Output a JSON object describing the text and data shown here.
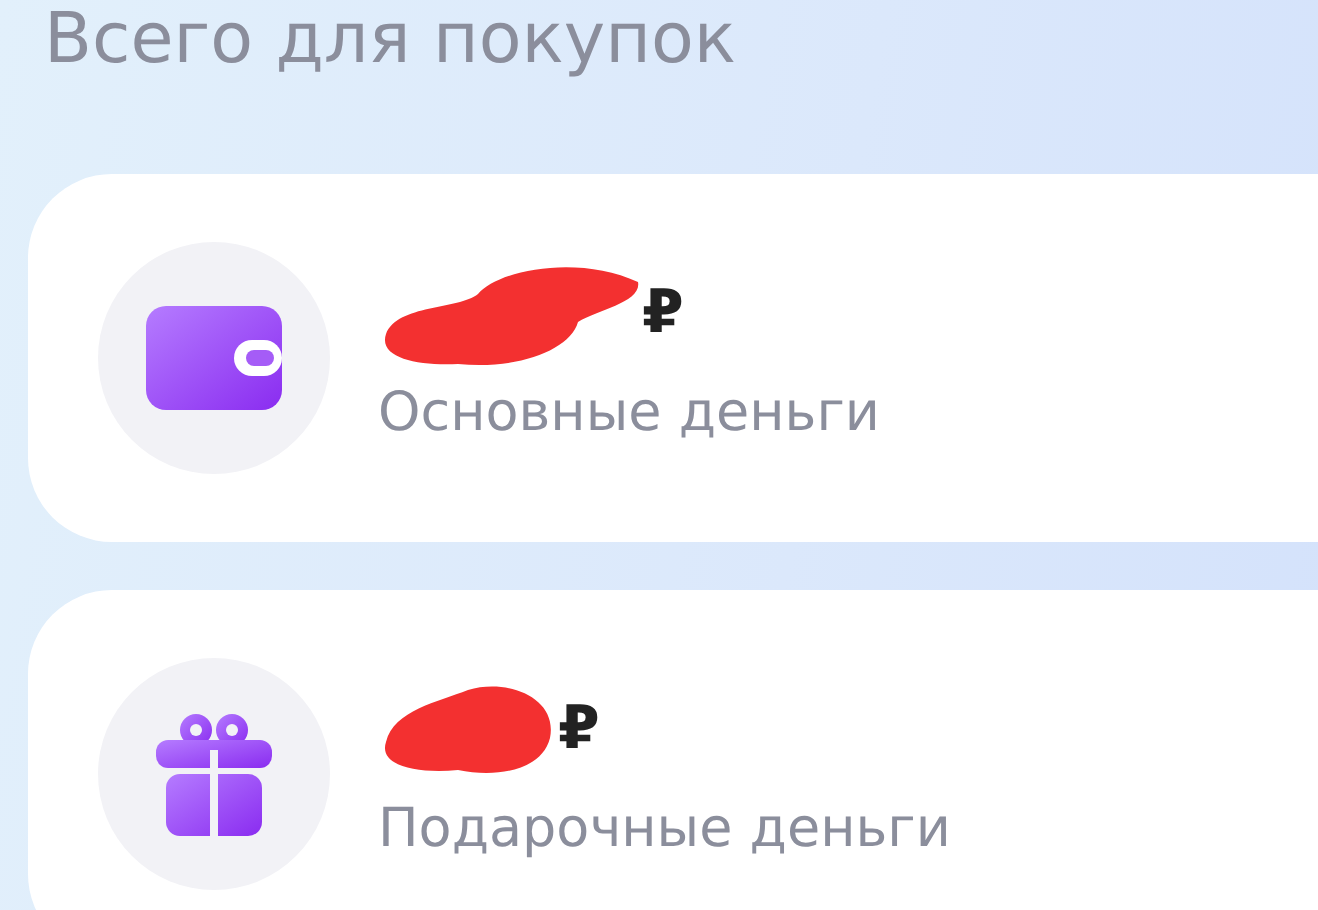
{
  "title": "Всего для покупок",
  "accounts": [
    {
      "kind": "wallet",
      "amount": "₽",
      "label": "Основные деньги"
    },
    {
      "kind": "gift",
      "amount": "₽",
      "label": "Подарочные деньги"
    }
  ]
}
